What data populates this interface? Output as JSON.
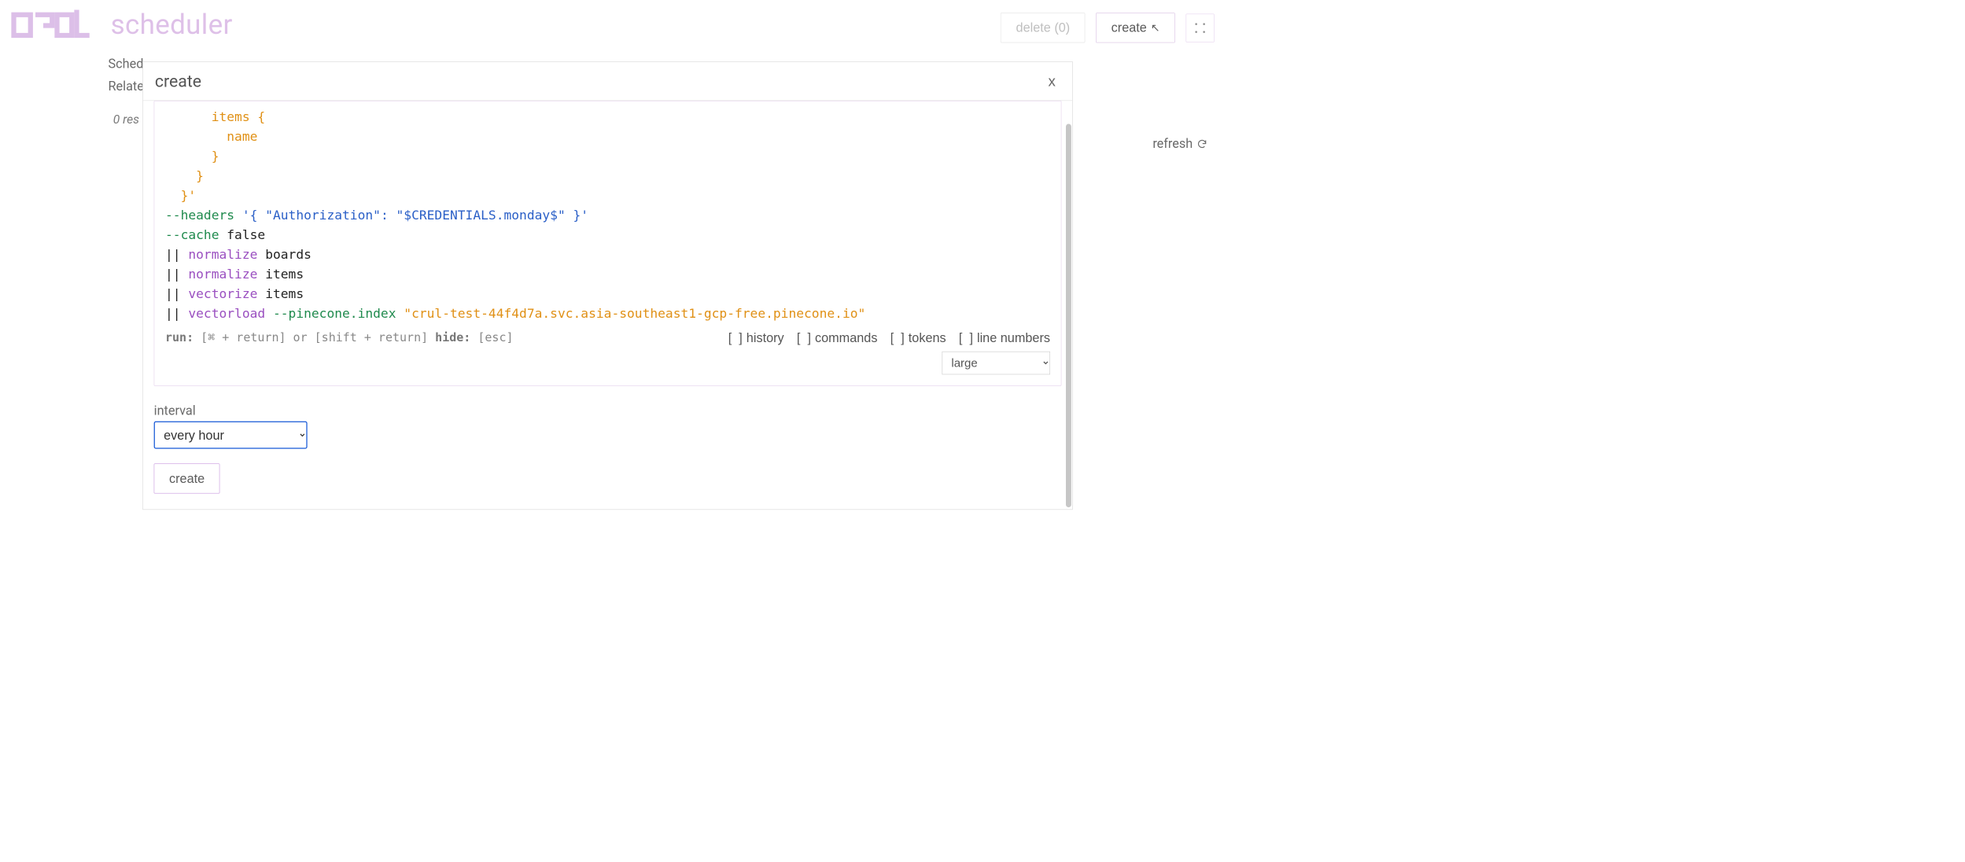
{
  "header": {
    "title": "scheduler",
    "delete_label": "delete (0)",
    "create_label": "create"
  },
  "tabs": {
    "scheduled": "Sched",
    "related": "Relate"
  },
  "results_text": "0 res",
  "refresh_label": "refresh",
  "modal": {
    "title": "create",
    "close": "x",
    "code": {
      "l1_indent": "      ",
      "l1_text": "items {",
      "l2_indent": "        ",
      "l2_text": "name",
      "l3_indent": "      ",
      "l3_text": "}",
      "l4_indent": "    ",
      "l4_text": "}",
      "l5_indent": "  ",
      "l5_text": "}'",
      "l6_flag": "--headers",
      "l6_str": " '{ \"Authorization\": \"$CREDENTIALS.monday$\" }'",
      "l7_flag": "--cache",
      "l7_rest": " false",
      "l8_pipe": "||",
      "l8_cmd": " normalize",
      "l8_arg": " boards",
      "l9_pipe": "||",
      "l9_cmd": " normalize",
      "l9_arg": " items",
      "l10_pipe": "||",
      "l10_cmd": " vectorize",
      "l10_arg": " items",
      "l11_pipe": "||",
      "l11_cmd": " vectorload",
      "l11_flag": " --pinecone.index",
      "l11_str": " \"crul-test-44f4d7a.svc.asia-southeast1-gcp-free.pinecone.io\""
    },
    "hints": {
      "run_label": "run:",
      "run_keys": " [⌘ + return] or [shift + return]  ",
      "hide_label": "hide:",
      "hide_keys": " [esc]"
    },
    "toggles": {
      "history": "history",
      "commands": "commands",
      "tokens": "tokens",
      "linenumbers": "line numbers"
    },
    "size_value": "large",
    "interval_label": "interval",
    "interval_value": "every hour",
    "create_button": "create"
  }
}
